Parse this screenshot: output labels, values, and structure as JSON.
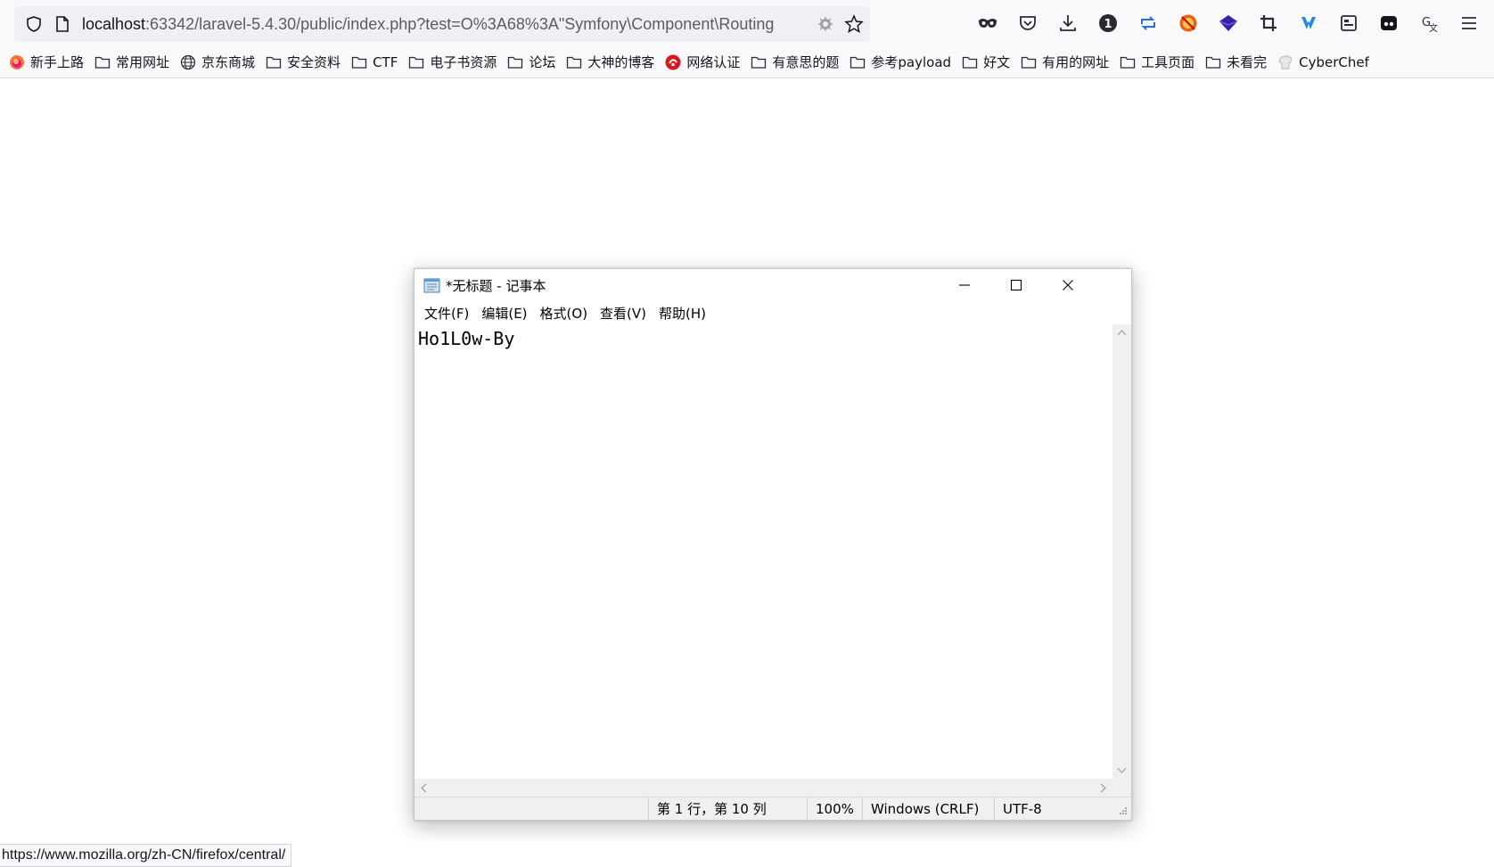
{
  "browser": {
    "url_host": "localhost",
    "url_rest": ":63342/laravel-5.4.30/public/index.php?test=O%3A68%3A\"Symfony\\Component\\Routing",
    "toolbar_icons": [
      "mask-icon",
      "pocket-icon",
      "download-icon",
      "onetab-icon",
      "sync-icon",
      "blocker-icon",
      "hackbar-icon",
      "crop-icon",
      "wappalyzer-icon",
      "reader-icon",
      "bitwarden-icon",
      "translate-icon",
      "menu-icon"
    ]
  },
  "bookmarks": [
    {
      "label": "新手上路",
      "icon": "firefox-icon"
    },
    {
      "label": "常用网址",
      "icon": "folder-icon"
    },
    {
      "label": "京东商城",
      "icon": "globe-icon"
    },
    {
      "label": "安全资料",
      "icon": "folder-icon"
    },
    {
      "label": "CTF",
      "icon": "folder-icon"
    },
    {
      "label": "电子书资源",
      "icon": "folder-icon"
    },
    {
      "label": "论坛",
      "icon": "folder-icon"
    },
    {
      "label": "大神的博客",
      "icon": "folder-icon"
    },
    {
      "label": "网络认证",
      "icon": "network-icon"
    },
    {
      "label": "有意思的题",
      "icon": "folder-icon"
    },
    {
      "label": "参考payload",
      "icon": "folder-icon"
    },
    {
      "label": "好文",
      "icon": "folder-icon"
    },
    {
      "label": "有用的网址",
      "icon": "folder-icon"
    },
    {
      "label": "工具页面",
      "icon": "folder-icon"
    },
    {
      "label": "未看完",
      "icon": "folder-icon"
    },
    {
      "label": "CyberChef",
      "icon": "chef-icon"
    }
  ],
  "notepad": {
    "title": "*无标题 - 记事本",
    "menu": [
      "文件(F)",
      "编辑(E)",
      "格式(O)",
      "查看(V)",
      "帮助(H)"
    ],
    "content": "Ho1L0w-By",
    "status": {
      "position": "第 1 行，第 10 列",
      "zoom": "100%",
      "line_ending": "Windows (CRLF)",
      "encoding": "UTF-8"
    }
  },
  "status_link": "https://www.mozilla.org/zh-CN/firefox/central/"
}
